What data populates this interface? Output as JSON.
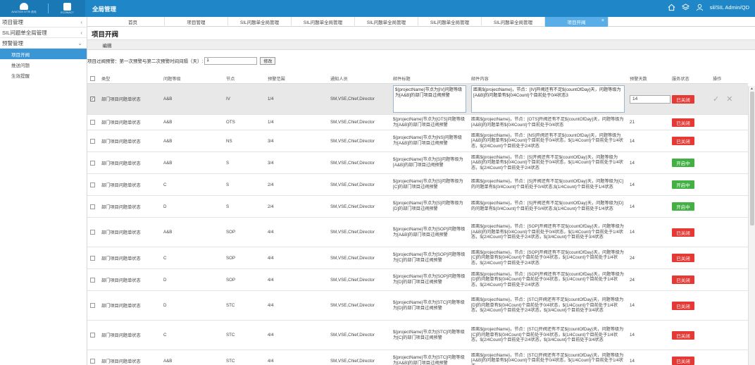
{
  "header": {
    "logo1_text": "AVIATION IVTRI 航电",
    "logo2_text": "ECOWACT",
    "app_title": "全局管理",
    "user": "sil/SIL Admin/QD"
  },
  "sidebar": {
    "groups": [
      {
        "label": "项目管理"
      },
      {
        "label": "SIL问题单全局管理"
      },
      {
        "label": "预警管理",
        "items": [
          "项目开阀",
          "推送问题",
          "生效提醒"
        ]
      }
    ]
  },
  "tabs": [
    "首页",
    "项目管理",
    "SIL问题单全局管理",
    "SIL问题单全局管理",
    "SIL问题单全局管理",
    "SIL问题单全局管理",
    "SIL问题单全局管理",
    "项目开阀"
  ],
  "page": {
    "title": "项目开阀",
    "subtab": "编辑",
    "filter_label": "项目过阀预警：第一次预警与第二次预警时间间隔（天）:",
    "filter_value": "1",
    "modify_button": "修改"
  },
  "columns": [
    "类型",
    "问题等级",
    "节点",
    "预警范围",
    "通知人员",
    "邮件标题",
    "邮件内容",
    "预警天数",
    "服务状态",
    "操作"
  ],
  "rows": [
    {
      "checked": true,
      "type": "部门项目问题单状态",
      "level": "A&B",
      "node": "IV",
      "range": "1/4",
      "notify": "SM,VSE,Chief,Director",
      "title": "${projectName}节点为[IV]问题等级为[A&B]的部门项目过阀预警",
      "content": "距离${projectName}，节点：[IV]开阀还有不足${countOfDay}天，问题等级为[A&B]的问题单有${0/4Count}个目前处于0/4状态3",
      "days": "14",
      "status": "已关闭",
      "status_on": false
    },
    {
      "checked": false,
      "type": "部门项目问题单状态",
      "level": "A&B",
      "node": "OTS",
      "range": "1/4",
      "notify": "SM,VSE,Chief,Director",
      "title": "${projectName}节点为[OTS]问题等级为[A&B]的部门项目过阀预警",
      "content": "距离${projectName}，节点：[OTS]开阀还有不足${countOfDay}天，问题等级为[A&B]的问题单有${0/4Count}个目前处于0/4状态",
      "days": "21",
      "status": "已关闭",
      "status_on": false
    },
    {
      "checked": false,
      "type": "部门项目问题单状态",
      "level": "A&B",
      "node": "NS",
      "range": "3/4",
      "notify": "SM,VSE,Chief,Director",
      "title": "${projectName}节点为[NS]问题等级为[A&B]的部门项目过阀预警",
      "content": "距离${projectName}，节点：[NS]开阀还有不足${countOfDay}天，问题等级为[A&B]的问题单有${0/4Count}个目前处于0/4状态，${1/4Count}个目前处于1/4状态，${2/4Count}个目前处于2/4状态",
      "days": "14",
      "status": "已关闭",
      "status_on": false
    },
    {
      "checked": false,
      "type": "部门项目问题单状态",
      "level": "A&B",
      "node": "S",
      "range": "3/4",
      "notify": "SM,VSE,Chief,Director",
      "title": "${projectName}节点为[S]问题等级为[A&B]的部门项目过阀预警",
      "content": "距离${projectName}，节点：[S]开阀还有不足${countOfDay}天，问题等级为[A&B]的问题单有${0/4Count}个目前处于0/4状态，${1/4Count}个目前处于1/4状态，${2/4Count}个目前处于2/4状态",
      "days": "14",
      "status": "开启中",
      "status_on": true
    },
    {
      "checked": false,
      "type": "部门项目问题单状态",
      "level": "C",
      "node": "S",
      "range": "2/4",
      "notify": "SM,VSE,Chief,Director",
      "title": "${projectName}节点为[S]问题等级为[C]的部门项目过阀预警",
      "content": "距离${projectName}，节点：[S]开阀还有不足${countOfDay}天，问题等级为[C]的问题单有${0/4Count}个目前处于0/4状态,${1/4Count}个目前处于1/4状态",
      "days": "14",
      "status": "开启中",
      "status_on": true
    },
    {
      "checked": false,
      "type": "部门项目问题单状态",
      "level": "D",
      "node": "S",
      "range": "2/4",
      "notify": "SM,VSE,Chief,Director",
      "title": "${projectName}节点为[S]问题等级为[D]的部门项目过阀预警",
      "content": "距离${projectName}，节点：[S]开阀还有不足${countOfDay}天，问题等级为[D]的问题单有${0/4Count}个目前处于0/4状态,${1/4Count}个目前处于1/4状态",
      "days": "14",
      "status": "开启中",
      "status_on": true
    },
    {
      "checked": false,
      "type": "部门项目问题单状态",
      "level": "A&B",
      "node": "SOP",
      "range": "4/4",
      "notify": "SM,VSE,Chief,Director",
      "title": "${projectName}节点为[SOP]问题等级为[A&B]的部门项目过阀预警",
      "content": "距离${projectName}，节点：[SOP]开阀还有不足${countOfDay}天，问题等级为[A&B]的问题单有${0/4Count}个目前处于0/4状态，${1/4Count}个目前处于1/4状态，${2/4Count}个目前处于2/4状态，${3/4Count}个目前处于3/4状态",
      "days": "14",
      "status": "已关闭",
      "status_on": false
    },
    {
      "checked": false,
      "type": "部门项目问题单状态",
      "level": "C",
      "node": "SOP",
      "range": "4/4",
      "notify": "SM,VSE,Chief,Director",
      "title": "${projectName}节点为[SOP]问题等级为[C]的部门项目过阀预警",
      "content": "距离${projectName}，节点：[SOP]开阀还有不足${countOfDay}天，问题等级为[C]的问题单有${0/4Count}个目前处于0/4状态，${1/4Count}个目前处于1/4状态，${2/4Count}个目前处于2/4状态",
      "days": "24",
      "status": "已关闭",
      "status_on": false
    },
    {
      "checked": false,
      "type": "部门项目问题单状态",
      "level": "D",
      "node": "SOP",
      "range": "4/4",
      "notify": "SM,VSE,Chief,Director",
      "title": "${projectName}节点为[SOP]问题等级为[D]的部门项目过阀预警",
      "content": "距离${projectName}，节点：[SOP]开阀还有不足${countOfDay}天，问题等级为[D]的问题单有${0/4Count}个目前处于0/4状态，${1/4Count}个目前处于1/4状态，${2/4Count}个目前处于2/4状态",
      "days": "24",
      "status": "已关闭",
      "status_on": false
    },
    {
      "checked": false,
      "type": "部门项目问题单状态",
      "level": "D",
      "node": "STC",
      "range": "4/4",
      "notify": "SM,VSE,Chief,Director",
      "title": "${projectName}节点为[STC]问题等级为[D]的部门项目过阀预警",
      "content": "距离${projectName}，节点：[STC]开阀还有不足${countOfDay}天，问题等级为[D]的问题单有${0/4Count}个目前处于0/4状态，${1/4Count}个目前处于1/4状态，${2/4Count}个目前处于2/4状态，${3/4Count}个目前处于3/4状态",
      "days": "14",
      "status": "已关闭",
      "status_on": false
    },
    {
      "checked": false,
      "type": "部门项目问题单状态",
      "level": "C",
      "node": "STC",
      "range": "4/4",
      "notify": "SM,VSE,Chief,Director",
      "title": "${projectName}节点为[STC]问题等级为[C]的部门项目过阀预警",
      "content": "距离${projectName}，节点：[STC]开阀还有不足${countOfDay}天，问题等级为[C]的问题单有${0/4Count}个目前处于0/4状态，${1/4Count}个目前处于1/4状态，${2/4Count}个目前处于2/4状态，${3/4Count}个目前处于3/4状态",
      "days": "14",
      "status": "已关闭",
      "status_on": false
    },
    {
      "checked": false,
      "type": "部门项目问题单状态",
      "level": "A&B",
      "node": "STC",
      "range": "4/4",
      "notify": "SM,VSE,Chief,Director",
      "title": "${projectName}节点为[STC]问题等级为[A&B]的部门项目过阀预警",
      "content": "距离${projectName}，节点：[STC]开阀还有不足${countOfDay}天，问题等级为[A&B]的问题单有${0/4Count}个目前处于0/4状态，${1/4Count}个目前处于1/4状态",
      "days": "14",
      "status": "已关闭",
      "status_on": false
    }
  ],
  "colors": {
    "topbar": "#1f87c8",
    "active_tab": "#5aaee8",
    "active_side": "#3a96d4",
    "closed": "#e53935",
    "open": "#43b043"
  }
}
